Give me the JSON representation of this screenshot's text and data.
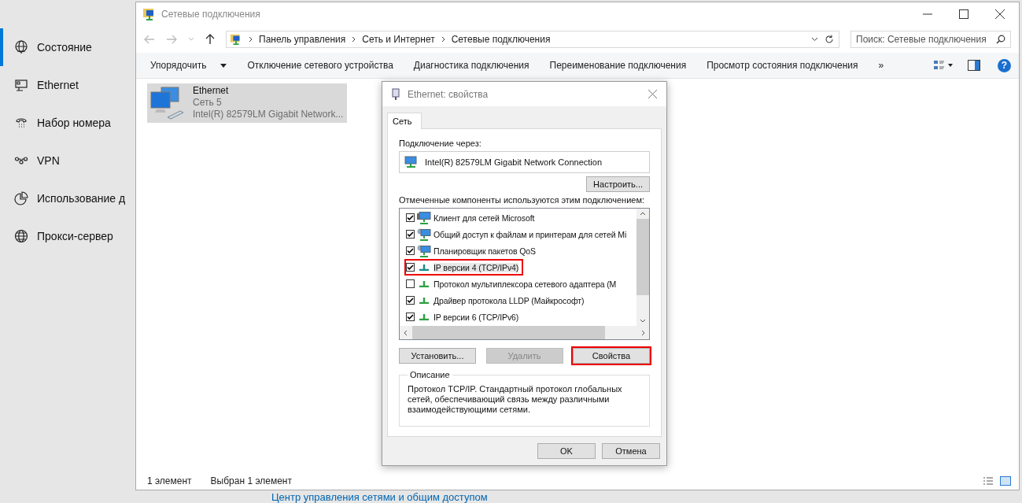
{
  "settings": {
    "items": [
      {
        "label": "Состояние",
        "selected": true
      },
      {
        "label": "Ethernet",
        "selected": false
      },
      {
        "label": "Набор номера",
        "selected": false
      },
      {
        "label": "VPN",
        "selected": false
      },
      {
        "label": "Использование д",
        "selected": false
      },
      {
        "label": "Прокси-сервер",
        "selected": false
      }
    ],
    "link": "Центр управления сетями и общим доступом"
  },
  "explorer": {
    "title": "Сетевые подключения",
    "address": [
      "Панель управления",
      "Сеть и Интернет",
      "Сетевые подключения"
    ],
    "search_placeholder": "Поиск: Сетевые подключения",
    "toolbar": [
      "Упорядочить",
      "Отключение сетевого устройства",
      "Диагностика подключения",
      "Переименование подключения",
      "Просмотр состояния подключения"
    ],
    "more": "»",
    "help": "?",
    "items": [
      {
        "name": "Ethernet",
        "network": "Сеть  5",
        "adapter": "Intel(R) 82579LM Gigabit Network...",
        "selected": true
      }
    ],
    "status_bar": [
      "1 элемент",
      "Выбран 1 элемент"
    ]
  },
  "dialog": {
    "title": "Ethernet: свойства",
    "tabs": [
      {
        "label": "Сеть",
        "selected": true
      }
    ],
    "connect_label": "Подключение через:",
    "adapter": "Intel(R) 82579LM Gigabit Network Connection",
    "configure": "Настроить...",
    "components_label": "Отмеченные компоненты используются этим подключением:",
    "components": [
      {
        "kind": "client",
        "label": "Клиент для сетей Microsoft",
        "checked": true,
        "selected": false,
        "highlighted": false
      },
      {
        "kind": "service",
        "label": "Общий доступ к файлам и принтерам для сетей Mi",
        "checked": true,
        "selected": false,
        "highlighted": false
      },
      {
        "kind": "service",
        "label": "Планировщик пакетов QoS",
        "checked": true,
        "selected": false,
        "highlighted": false
      },
      {
        "kind": "protocol",
        "label": "IP версии 4 (TCP/IPv4)",
        "checked": true,
        "selected": true,
        "highlighted": true
      },
      {
        "kind": "protocol",
        "label": "Протокол мультиплексора сетевого адаптера (М",
        "checked": false,
        "selected": false,
        "highlighted": false
      },
      {
        "kind": "protocol",
        "label": "Драйвер протокола LLDP (Майкрософт)",
        "checked": true,
        "selected": false,
        "highlighted": false
      },
      {
        "kind": "protocol",
        "label": "IP версии 6 (TCP/IPv6)",
        "checked": true,
        "selected": false,
        "highlighted": false
      }
    ],
    "buttons": [
      {
        "label": "Установить...",
        "disabled": false,
        "highlighted": false
      },
      {
        "label": "Удалить",
        "disabled": true,
        "highlighted": false
      },
      {
        "label": "Свойства",
        "disabled": false,
        "highlighted": true
      }
    ],
    "description_title": "Описание",
    "description": "Протокол TCP/IP. Стандартный протокол глобальных сетей, обеспечивающий связь между различными взаимодействующими сетями.",
    "footer": [
      "OK",
      "Отмена"
    ]
  }
}
